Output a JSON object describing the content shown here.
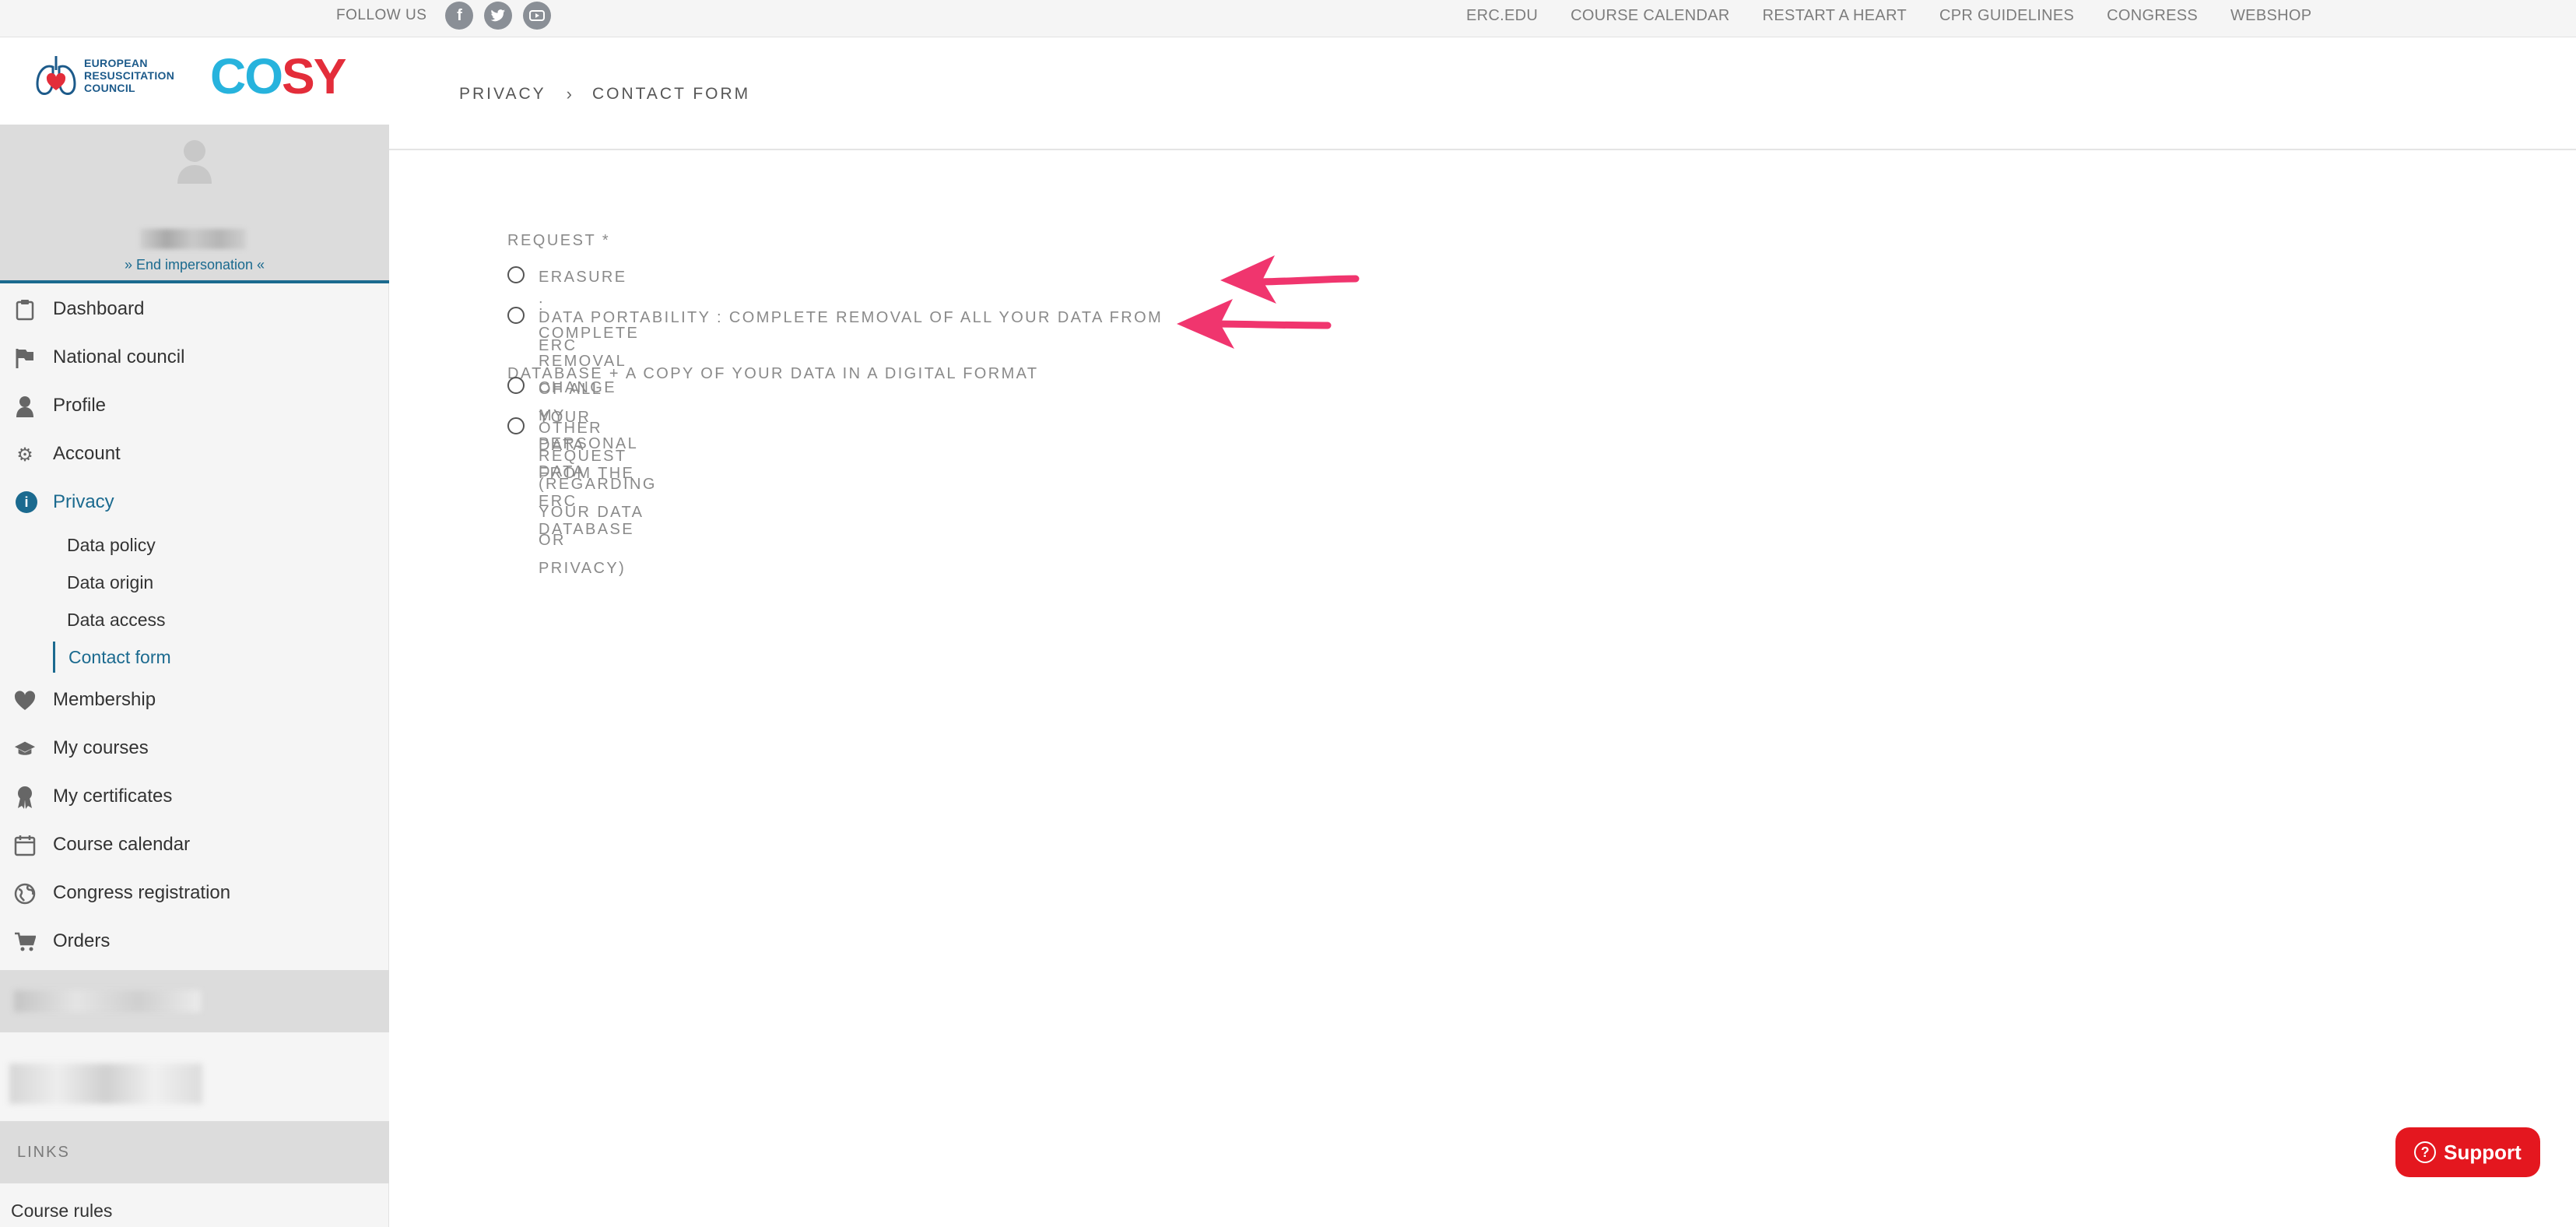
{
  "topbar": {
    "follow_label": "FOLLOW US",
    "social": [
      "facebook-icon",
      "twitter-icon",
      "youtube-icon"
    ],
    "nav": [
      "ERC.EDU",
      "COURSE CALENDAR",
      "RESTART A HEART",
      "CPR GUIDELINES",
      "CONGRESS",
      "WEBSHOP"
    ]
  },
  "logo": {
    "erc_line1": "EUROPEAN",
    "erc_line2": "RESUSCITATION",
    "erc_line3": "COUNCIL",
    "cosy_co": "CO",
    "cosy_sy": "SY"
  },
  "user": {
    "end_impersonation": "» End impersonation «"
  },
  "sidebar": {
    "items": [
      {
        "label": "Dashboard",
        "icon": "clipboard-icon"
      },
      {
        "label": "National council",
        "icon": "flag-icon"
      },
      {
        "label": "Profile",
        "icon": "user-icon"
      },
      {
        "label": "Account",
        "icon": "gear-icon"
      },
      {
        "label": "Privacy",
        "icon": "info-icon"
      },
      {
        "label": "Membership",
        "icon": "heart-icon"
      },
      {
        "label": "My courses",
        "icon": "graduation-cap-icon"
      },
      {
        "label": "My certificates",
        "icon": "ribbon-icon"
      },
      {
        "label": "Course calendar",
        "icon": "calendar-icon"
      },
      {
        "label": "Congress registration",
        "icon": "globe-icon"
      },
      {
        "label": "Orders",
        "icon": "cart-icon"
      }
    ],
    "privacy_sub": [
      "Data policy",
      "Data origin",
      "Data access",
      "Contact form"
    ],
    "links_heading": "LINKS",
    "links": [
      "Course rules"
    ]
  },
  "breadcrumb": {
    "parent": "PRIVACY",
    "current": "CONTACT FORM"
  },
  "form": {
    "request_label": "REQUEST *",
    "options": [
      "ERASURE : COMPLETE REMOVAL OF ALL YOUR DATA FROM THE ERC DATABASE",
      "DATA PORTABILITY : COMPLETE REMOVAL OF ALL YOUR DATA FROM ERC",
      "DATABASE + A COPY OF YOUR DATA IN A DIGITAL FORMAT",
      "CHANGE MY PERSONAL DATA",
      "OTHER REQUEST (REGARDING YOUR DATA OR PRIVACY)"
    ]
  },
  "support_label": "Support",
  "colors": {
    "accent": "#1b6a8f",
    "annotation_arrow": "#f0356e",
    "support": "#e4171f"
  }
}
